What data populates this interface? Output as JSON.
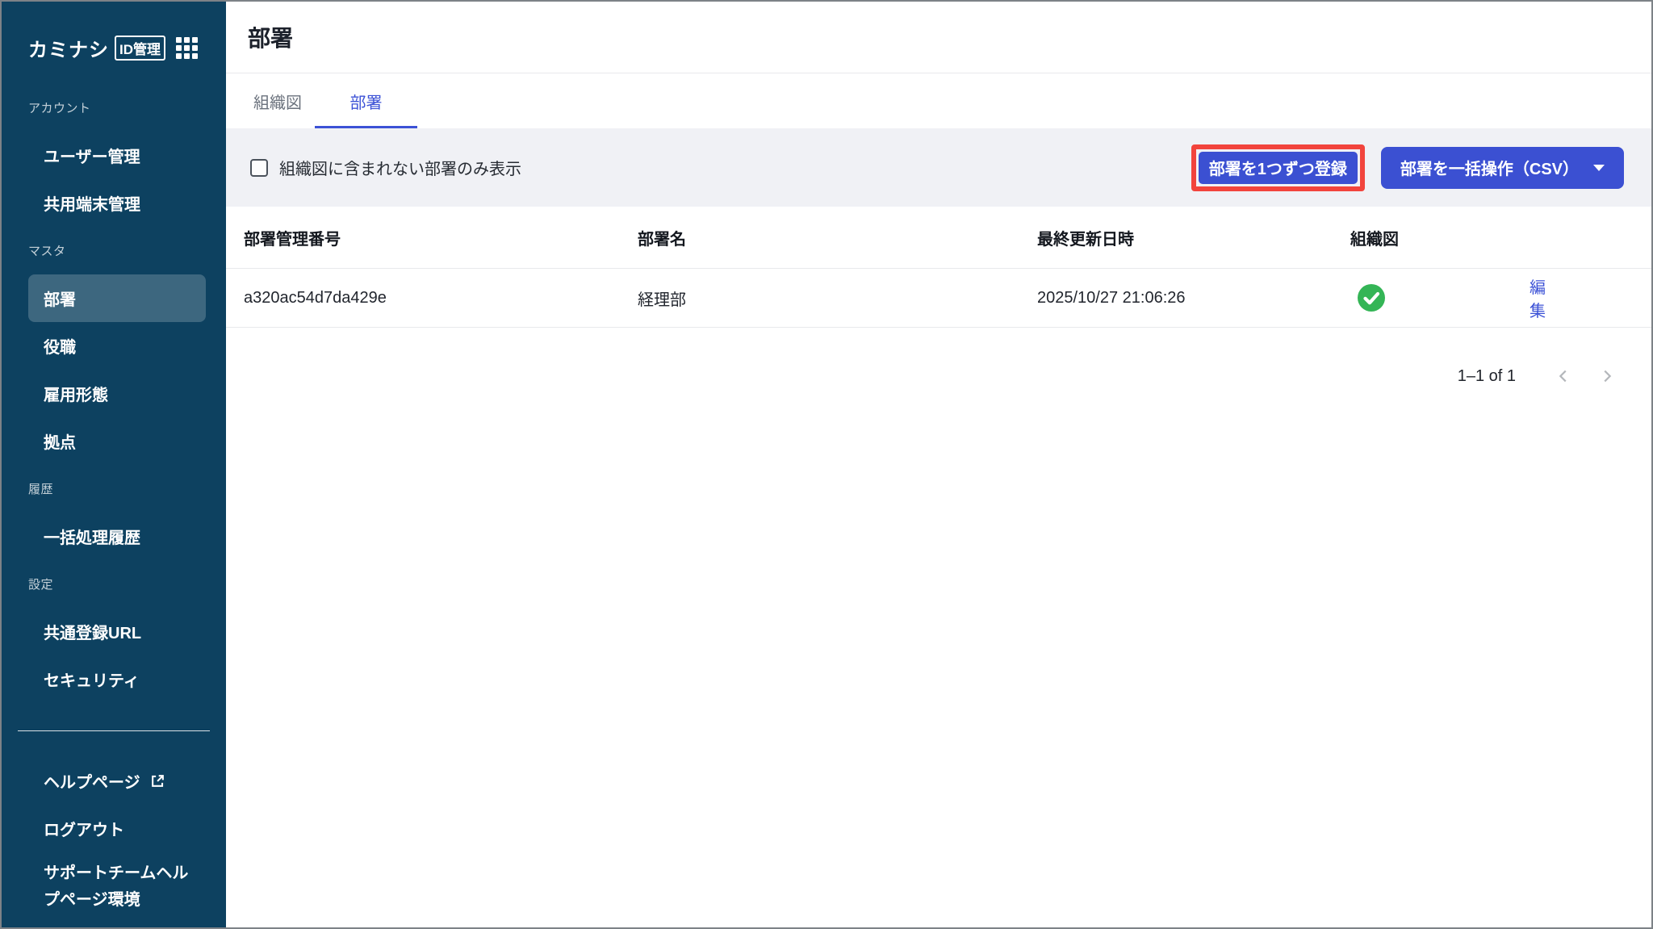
{
  "app": {
    "brand": "カミナシ",
    "brand_badge": "ID管理"
  },
  "sidebar": {
    "groups": [
      {
        "label": "アカウント",
        "items": [
          {
            "label": "ユーザー管理"
          },
          {
            "label": "共用端末管理"
          }
        ]
      },
      {
        "label": "マスタ",
        "items": [
          {
            "label": "部署",
            "selected": true
          },
          {
            "label": "役職"
          },
          {
            "label": "雇用形態"
          },
          {
            "label": "拠点"
          }
        ]
      },
      {
        "label": "履歴",
        "items": [
          {
            "label": "一括処理履歴"
          }
        ]
      },
      {
        "label": "設定",
        "items": [
          {
            "label": "共通登録URL"
          },
          {
            "label": "セキュリティ"
          }
        ]
      }
    ],
    "footer": [
      {
        "label": "ヘルプページ",
        "external": true
      },
      {
        "label": "ログアウト"
      },
      {
        "label": "サポートチームヘルプページ環境"
      }
    ]
  },
  "header": {
    "title": "部署"
  },
  "tabs": {
    "items": [
      {
        "label": "組織図",
        "active": false
      },
      {
        "label": "部署",
        "active": true
      }
    ]
  },
  "filter": {
    "checkbox_label": "組織図に含まれない部署のみ表示",
    "checked": false
  },
  "actions": {
    "register_label": "部署を1つずつ登録",
    "bulk_label": "部署を一括操作（CSV）"
  },
  "table": {
    "columns": [
      "部署管理番号",
      "部署名",
      "最終更新日時",
      "組織図"
    ],
    "rows": [
      {
        "id": "a320ac54d7da429e",
        "name": "経理部",
        "updated": "2025/10/27 21:06:26",
        "in_org_chart": true,
        "edit_label": "編集"
      }
    ]
  },
  "pagination": {
    "range_label": "1–1 of 1"
  },
  "colors": {
    "sidebar_bg": "#0d4160",
    "accent_blue": "#3c52d6",
    "button_blue": "#3b50d2",
    "annotation_red": "#f2443c",
    "success_green": "#34b556",
    "filter_bar_bg": "#f0f1f5"
  }
}
